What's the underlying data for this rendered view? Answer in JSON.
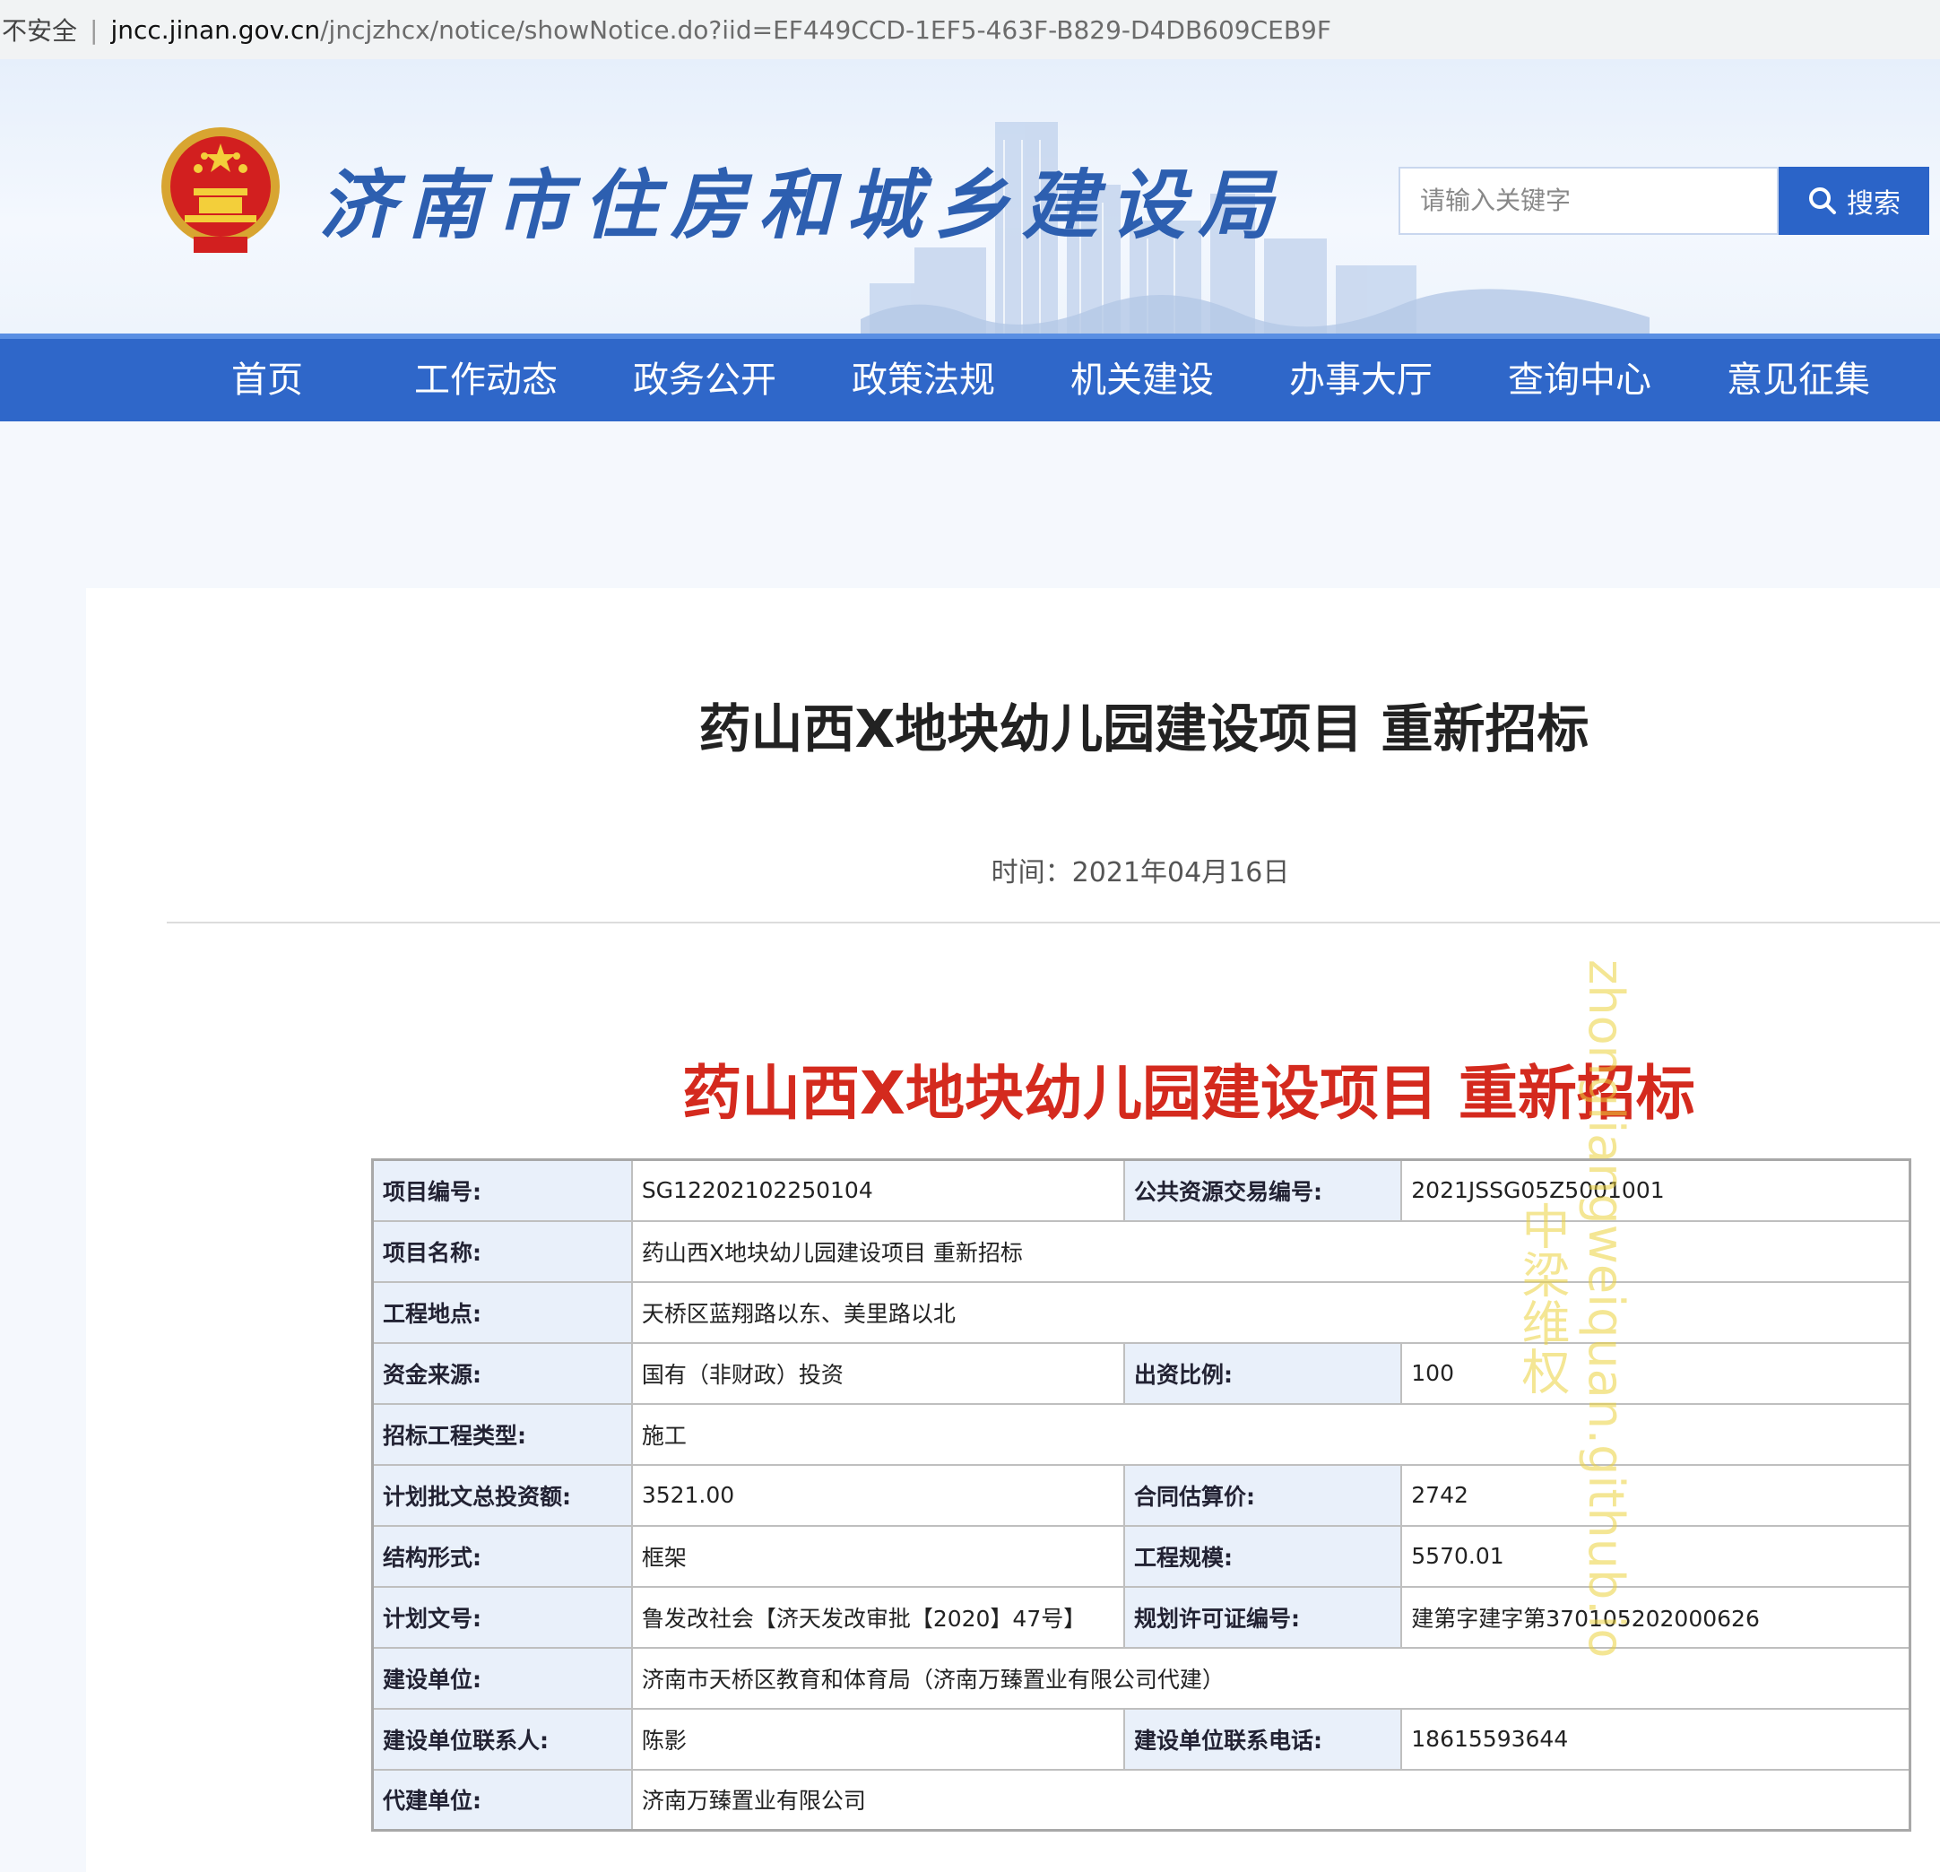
{
  "browser": {
    "security_label": "不安全",
    "url_domain": "jncc.jinan.gov.cn",
    "url_path": "/jncjzhcx/notice/showNotice.do?iid=EF449CCD-1EF5-463F-B829-D4DB609CEB9F"
  },
  "header": {
    "site_title": "济南市住房和城乡建设局",
    "search_placeholder": "请输入关键字",
    "search_button_label": "搜索",
    "emblem_icon": "national-emblem-icon",
    "colors": {
      "brand_blue": "#2f67c9",
      "title_blue": "#2d5fb0",
      "accent_red": "#d42a1e"
    }
  },
  "nav": {
    "items": [
      "首页",
      "工作动态",
      "政务公开",
      "政策法规",
      "机关建设",
      "办事大厅",
      "查询中心",
      "意见征集"
    ]
  },
  "article": {
    "title": "药山西X地块幼儿园建设项目 重新招标",
    "time_label": "时间：2021年04月16日",
    "headline": "药山西X地块幼儿园建设项目 重新招标",
    "watermark_cn": "中梁维权",
    "watermark_en": "zhongliangweiquan.github.io"
  },
  "table": {
    "rows": [
      {
        "l1": "项目编号:",
        "v1": "SG12202102250104",
        "l2": "公共资源交易编号:",
        "v2": "2021JSSG05Z5001001"
      },
      {
        "l1": "项目名称:",
        "v1": "药山西X地块幼儿园建设项目 重新招标"
      },
      {
        "l1": "工程地点:",
        "v1": "天桥区蓝翔路以东、美里路以北"
      },
      {
        "l1": "资金来源:",
        "v1": "国有（非财政）投资",
        "l2": "出资比例:",
        "v2": "100"
      },
      {
        "l1": "招标工程类型:",
        "v1": "施工"
      },
      {
        "l1": "计划批文总投资额:",
        "v1": "3521.00",
        "l2": "合同估算价:",
        "v2": "2742"
      },
      {
        "l1": "结构形式:",
        "v1": "框架",
        "l2": "工程规模:",
        "v2": "5570.01"
      },
      {
        "l1": "计划文号:",
        "v1": "鲁发改社会【济天发改审批【2020】47号】",
        "l2": "规划许可证编号:",
        "v2": "建第字建字第370105202000626"
      },
      {
        "l1": "建设单位:",
        "v1": "济南市天桥区教育和体育局（济南万臻置业有限公司代建）"
      },
      {
        "l1": "建设单位联系人:",
        "v1": "陈影",
        "l2": "建设单位联系电话:",
        "v2": "18615593644"
      },
      {
        "l1": "代建单位:",
        "v1": "济南万臻置业有限公司"
      }
    ]
  }
}
